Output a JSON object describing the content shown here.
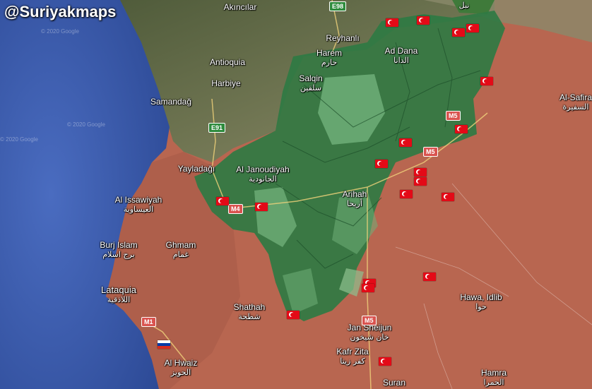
{
  "watermark": "@Suriyakmaps",
  "map_faint_labels": [
    "© 2020 Google",
    "© 2020 Google",
    "© 2020 Google"
  ],
  "places": [
    {
      "id": "akincilar",
      "name": "Akıncılar",
      "ar": ""
    },
    {
      "id": "reyhanli",
      "name": "Reyhanlı",
      "ar": ""
    },
    {
      "id": "antioquia",
      "name": "Antioquia",
      "ar": ""
    },
    {
      "id": "harbiye",
      "name": "Harbiye",
      "ar": ""
    },
    {
      "id": "samandag",
      "name": "Samandağ",
      "ar": ""
    },
    {
      "id": "harem",
      "name": "Harem",
      "ar": "حارم"
    },
    {
      "id": "ad-dana",
      "name": "Ad Dana",
      "ar": "الدانا"
    },
    {
      "id": "salqin",
      "name": "Salqin",
      "ar": "سلقين"
    },
    {
      "id": "al-safira",
      "name": "Al-Safira",
      "ar": "السفيرة"
    },
    {
      "id": "yayladagi",
      "name": "Yayladağı",
      "ar": ""
    },
    {
      "id": "al-janoudiyah",
      "name": "Al Janoudiyah",
      "ar": "الجانودية"
    },
    {
      "id": "arihah",
      "name": "Arihah",
      "ar": "أريحا"
    },
    {
      "id": "al-issawiyah",
      "name": "Al Issawiyah",
      "ar": "العيساوية"
    },
    {
      "id": "burj-islam",
      "name": "Burj Islam",
      "ar": "برج اسلام"
    },
    {
      "id": "ghmam",
      "name": "Ghmam",
      "ar": "غمام"
    },
    {
      "id": "lataquia",
      "name": "Lataquia",
      "ar": "اللاذقية"
    },
    {
      "id": "shathah",
      "name": "Shathah",
      "ar": "شطحة"
    },
    {
      "id": "hawa-idlib",
      "name": "Hawa, Idlib",
      "ar": "حوا"
    },
    {
      "id": "jan-sheijun",
      "name": "Jan Sheijun",
      "ar": "خان شيخون"
    },
    {
      "id": "kafr-zita",
      "name": "Kafr Zita",
      "ar": "كفر زيتا"
    },
    {
      "id": "al-hwaiz",
      "name": "Al Hwaiz",
      "ar": "الحويز"
    },
    {
      "id": "suran",
      "name": "Suran",
      "ar": ""
    },
    {
      "id": "hamra",
      "name": "Hamra",
      "ar": "الحمرا"
    },
    {
      "id": "top-right-ar",
      "name": "",
      "ar": "نبل"
    }
  ],
  "roads": [
    {
      "id": "e98",
      "label": "E98",
      "style": "green"
    },
    {
      "id": "e91",
      "label": "E91",
      "style": "green"
    },
    {
      "id": "m5-a",
      "label": "M5",
      "style": "red"
    },
    {
      "id": "m5-b",
      "label": "M5",
      "style": "red"
    },
    {
      "id": "m5-c",
      "label": "M5",
      "style": "red"
    },
    {
      "id": "m4",
      "label": "M4",
      "style": "red"
    },
    {
      "id": "m1",
      "label": "M1",
      "style": "red"
    }
  ],
  "markers": {
    "turkey_flag_count": 19,
    "russia_flag_count": 1
  },
  "colors": {
    "sea": "#3a5aa8",
    "government_area": "#b86650",
    "opposition_area": "#2f7a43",
    "opposition_light": "#6fae78",
    "turkey_terrain": "#5d6a44"
  }
}
